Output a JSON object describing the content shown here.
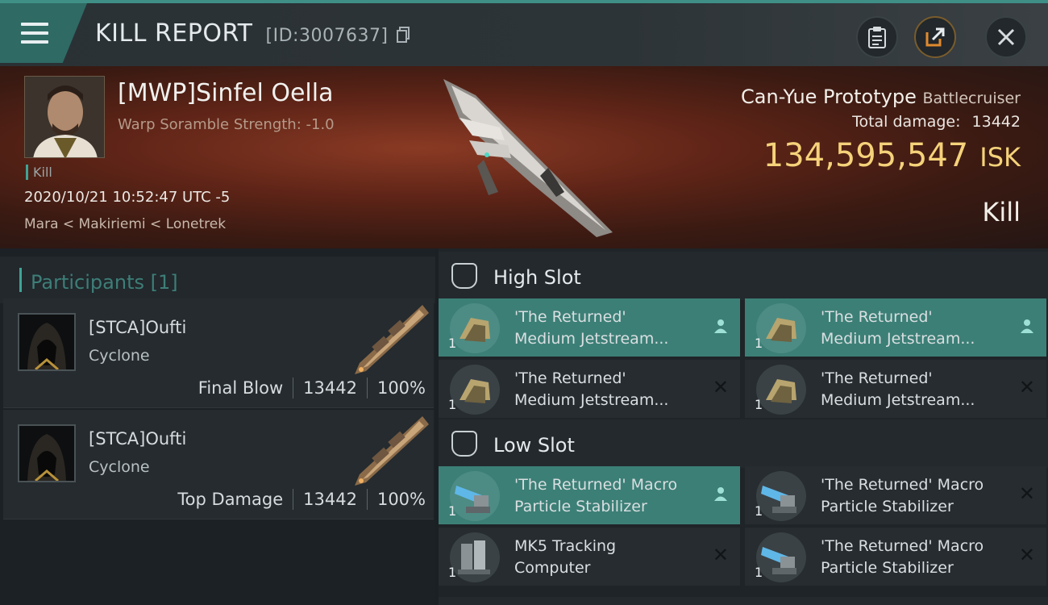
{
  "window": {
    "title": "KILL REPORT",
    "report_id": "[ID:3007637]",
    "icons": [
      "menu-icon",
      "copy-icon",
      "clipboard-icon",
      "share-icon",
      "close-icon"
    ]
  },
  "victim": {
    "name": "[MWP]Sinfel Oella",
    "scramble": "Warp Soramble Strength: -1.0",
    "tag": "Kill",
    "time": "2020/10/21 10:52:47 UTC -5",
    "location": "Mara < Makiriemi < Lonetrek",
    "ship": "Can-Yue Prototype",
    "ship_class": "Battlecruiser",
    "total_damage_label": "Total damage:",
    "total_damage": "13442",
    "isk_value": "134,595,547",
    "isk_unit": "ISK",
    "result": "Kill"
  },
  "participants": {
    "title": "Participants",
    "count": "[1]",
    "rows": [
      {
        "name": "[STCA]Oufti",
        "ship": "Cyclone",
        "role": "Final Blow",
        "damage": "13442",
        "percent": "100%"
      },
      {
        "name": "[STCA]Oufti",
        "ship": "Cyclone",
        "role": "Top Damage",
        "damage": "13442",
        "percent": "100%"
      }
    ]
  },
  "fitting": {
    "high_slot": {
      "title": "High Slot",
      "items": [
        {
          "l1": "'The Returned'",
          "l2": "Medium Jetstream...",
          "qty": "1",
          "state": "active",
          "mark": "person-icon"
        },
        {
          "l1": "'The Returned'",
          "l2": "Medium Jetstream...",
          "qty": "1",
          "state": "active",
          "mark": "person-icon"
        },
        {
          "l1": "'The Returned'",
          "l2": "Medium Jetstream...",
          "qty": "1",
          "state": "destroyed",
          "mark": "x"
        },
        {
          "l1": "'The Returned'",
          "l2": "Medium Jetstream...",
          "qty": "1",
          "state": "destroyed",
          "mark": "x"
        }
      ]
    },
    "low_slot": {
      "title": "Low Slot",
      "items": [
        {
          "l1": "'The Returned' Macro",
          "l2": "Particle Stabilizer",
          "qty": "1",
          "state": "active",
          "mark": "person-icon"
        },
        {
          "l1": "'The Returned' Macro",
          "l2": "Particle Stabilizer",
          "qty": "1",
          "state": "destroyed",
          "mark": "x"
        },
        {
          "l1": "MK5 Tracking",
          "l2": "Computer",
          "qty": "1",
          "state": "destroyed",
          "mark": "x"
        },
        {
          "l1": "'The Returned' Macro",
          "l2": "Particle Stabilizer",
          "qty": "1",
          "state": "destroyed",
          "mark": "x"
        }
      ]
    }
  },
  "colors": {
    "accent": "#3fa496",
    "isk": "#f5d27a",
    "active_slot": "#3c7f76"
  }
}
